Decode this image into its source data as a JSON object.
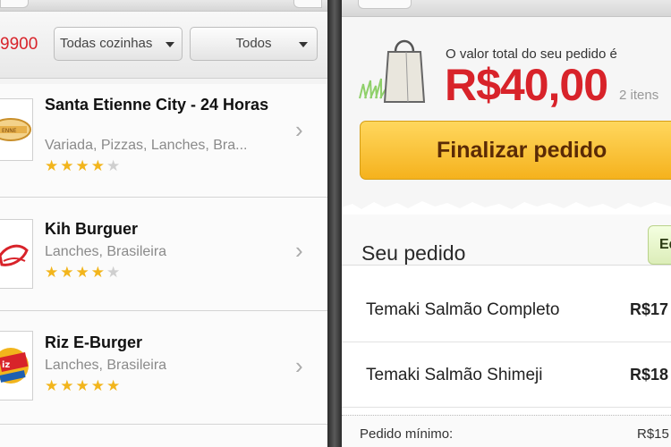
{
  "left_screen": {
    "phone_partial": "9900",
    "cuisine_filter": {
      "selected": "Todas cozinhas"
    },
    "general_filter": {
      "selected": "Todos"
    },
    "restaurants": [
      {
        "name": "Santa Etienne City - 24 Horas",
        "categories": "Variada, Pizzas, Lanches, Bra...",
        "rating": 4,
        "logo_icon": "santa-etienne-logo-icon"
      },
      {
        "name": "Kih Burguer",
        "categories": "Lanches, Brasileira",
        "rating": 4,
        "logo_icon": "kih-burguer-logo-icon"
      },
      {
        "name": "Riz E-Burger",
        "categories": "Lanches, Brasileira",
        "rating": 5,
        "logo_icon": "riz-e-burger-logo-icon"
      }
    ]
  },
  "right_screen": {
    "total_label": "O valor total do seu pedido é",
    "total_value": "R$40,00",
    "items_count": "2 itens",
    "finalize_label": "Finalizar pedido",
    "order_title": "Seu pedido",
    "edit_label": "Ed",
    "items": [
      {
        "name": "Temaki Salmão Completo",
        "price": "R$17"
      },
      {
        "name": "Temaki Salmão Shimeji",
        "price": "R$18"
      }
    ],
    "minimum": {
      "label": "Pedido mínimo:",
      "value": "R$15"
    }
  },
  "colors": {
    "brand_red": "#d8232a",
    "button_orange": "#f5b21d",
    "star_yellow": "#f2b51c",
    "edit_green": "#dcedb9"
  }
}
